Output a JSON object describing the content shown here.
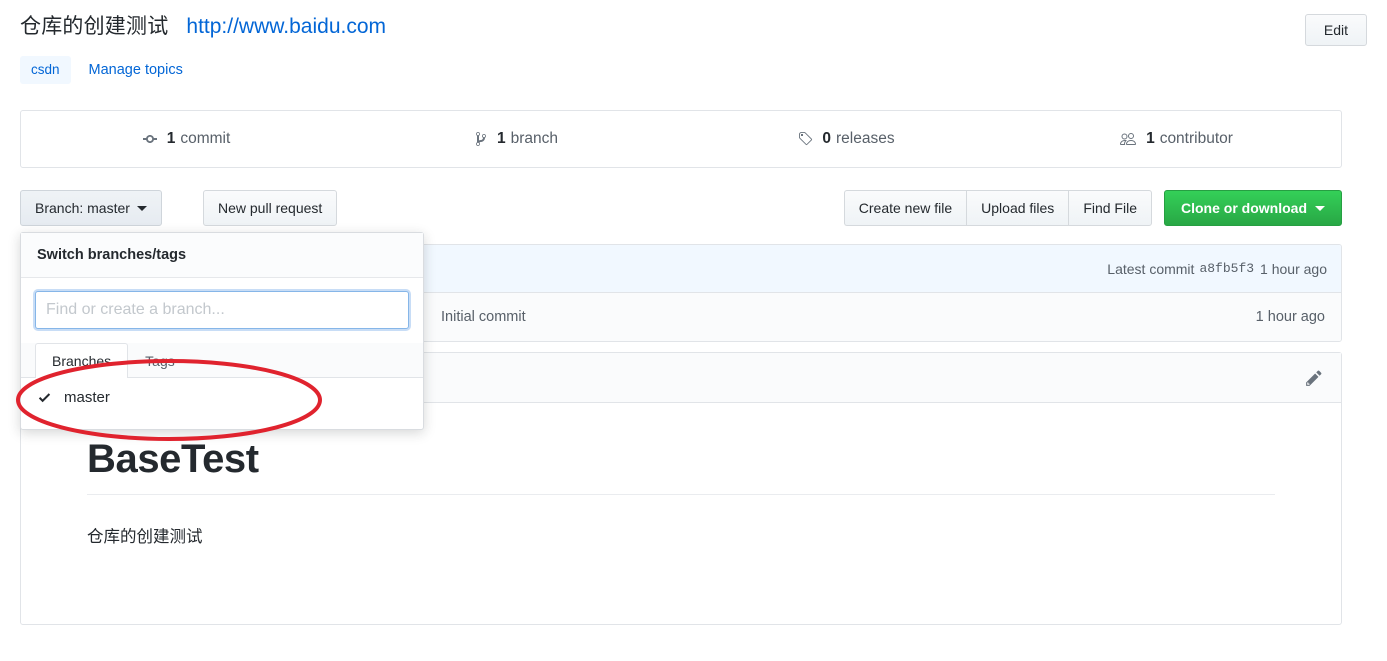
{
  "header": {
    "description": "仓库的创建测试",
    "url": "http://www.baidu.com",
    "edit_label": "Edit",
    "topic_tag": "csdn",
    "manage_topics_label": "Manage topics"
  },
  "numbers_summary": [
    {
      "icon": "git-commit-icon",
      "value": "1",
      "label": "commit"
    },
    {
      "icon": "git-branch-icon",
      "value": "1",
      "label": "branch"
    },
    {
      "icon": "tag-icon",
      "value": "0",
      "label": "releases"
    },
    {
      "icon": "people-icon",
      "value": "1",
      "label": "contributor"
    }
  ],
  "toolbar": {
    "branch_button": "Branch: master",
    "new_pull_request": "New pull request",
    "create_new_file": "Create new file",
    "upload_files": "Upload files",
    "find_file": "Find File",
    "clone_or_download": "Clone or download"
  },
  "commit_tease": {
    "prefix": "Latest commit",
    "sha": "a8fb5f3",
    "age": "1 hour ago"
  },
  "file_rows": [
    {
      "name": "",
      "message": "Initial commit",
      "age": "1 hour ago"
    }
  ],
  "readme": {
    "edit_icon": "pencil-icon",
    "heading": "BaseTest",
    "paragraph": "仓库的创建测试"
  },
  "branch_menu": {
    "title": "Switch branches/tags",
    "filter_placeholder": "Find or create a branch...",
    "filter_value": "",
    "tabs": [
      {
        "label": "Branches",
        "active": true
      },
      {
        "label": "Tags",
        "active": false
      }
    ],
    "items": [
      {
        "label": "master",
        "selected": true
      }
    ]
  },
  "annotation": {
    "shape": "ellipse",
    "color": "#e0232e"
  }
}
